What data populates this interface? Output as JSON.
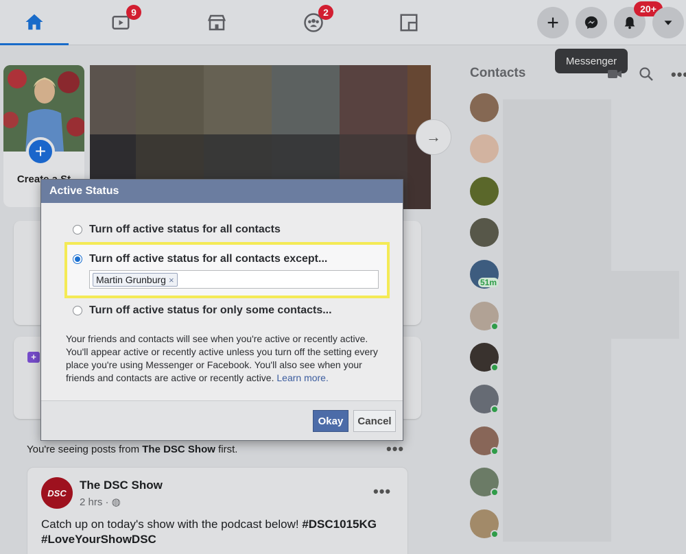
{
  "nav": {
    "watch_badge": "9",
    "groups_badge": "2",
    "notifications_badge": "20+",
    "messenger_tooltip": "Messenger"
  },
  "stories": {
    "create_label": "Create a St"
  },
  "feed": {
    "seeing_prefix": "You're seeing posts from ",
    "seeing_page": "The DSC Show",
    "seeing_suffix": " first.",
    "post": {
      "avatar_text": "DSC",
      "page_name": "The DSC Show",
      "time": "2 hrs · ",
      "body_text": "Catch up on today's show with the podcast below! ",
      "hashtag1": "#DSC1015KG",
      "hashtag2": "#LoveYourShowDSC"
    }
  },
  "contacts": {
    "title": "Contacts",
    "time_badge": "51m"
  },
  "modal": {
    "title": "Active Status",
    "option1": "Turn off active status for all contacts",
    "option2": "Turn off active status for all contacts except...",
    "option3": "Turn off active status for only some contacts...",
    "token": "Martin Grunburg",
    "token_remove": "×",
    "description": "Your friends and contacts will see when you're active or recently active. You'll appear active or recently active unless you turn off the setting every place you're using Messenger or Facebook. You'll also see when your friends and contacts are active or recently active. ",
    "learn_more": "Learn more.",
    "okay": "Okay",
    "cancel": "Cancel"
  },
  "colors": {
    "accent_blue": "#1a6fd0",
    "badge_red": "#d91f33",
    "highlight_yellow": "#f4ea56",
    "modal_header": "#6b7da0"
  }
}
